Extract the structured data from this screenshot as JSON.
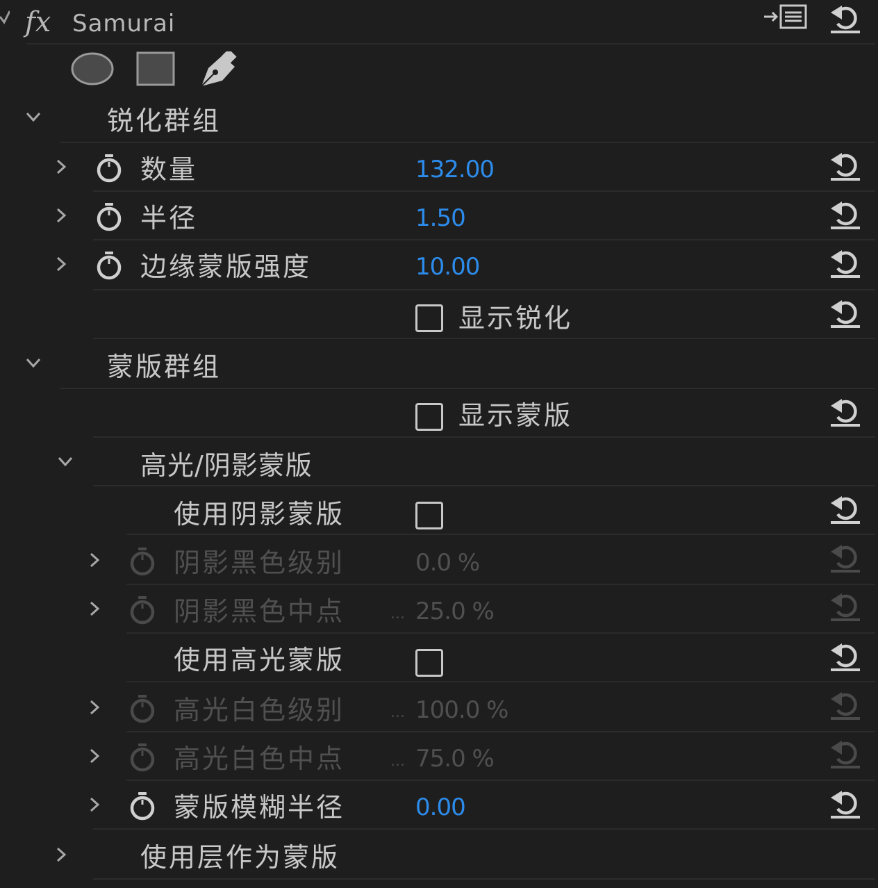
{
  "effect": {
    "name": "Samurai",
    "fx_label": "fx"
  },
  "header_icons": [
    "export-list-icon",
    "reset-icon"
  ],
  "mask_tools": [
    "ellipse-mask-icon",
    "rectangle-mask-icon",
    "pen-mask-icon"
  ],
  "groups": {
    "sharpen": {
      "label": "锐化群组"
    },
    "mask": {
      "label": "蒙版群组"
    },
    "highlight_shadow": {
      "label": "高光/阴影蒙版"
    },
    "use_layer": {
      "label": "使用层作为蒙版"
    }
  },
  "params": {
    "amount": {
      "label": "数量",
      "value": "132.00"
    },
    "radius": {
      "label": "半径",
      "value": "1.50"
    },
    "edge_mask": {
      "label": "边缘蒙版强度",
      "value": "10.00"
    },
    "show_sharpen": {
      "label": "显示锐化",
      "checked": false
    },
    "show_mask": {
      "label": "显示蒙版",
      "checked": false
    },
    "use_shadow_mask": {
      "label": "使用阴影蒙版",
      "checked": false
    },
    "shadow_black_level": {
      "label": "阴影黑色级别",
      "value": "0.0 %"
    },
    "shadow_black_mid": {
      "label": "阴影黑色中点",
      "value": "25.0 %",
      "ellipsis": "..."
    },
    "use_highlight_mask": {
      "label": "使用高光蒙版",
      "checked": false
    },
    "highlight_white_level": {
      "label": "高光白色级别",
      "value": "100.0 %",
      "ellipsis": "..."
    },
    "highlight_white_mid": {
      "label": "高光白色中点",
      "value": "75.0 %",
      "ellipsis": "..."
    },
    "mask_blur_radius": {
      "label": "蒙版模糊半径",
      "value": "0.00"
    }
  },
  "colors": {
    "bg": "#1e1e1e",
    "value_blue": "#2d8ceb",
    "text": "#c8c8c8",
    "disabled": "#505050",
    "separator": "#2b2b2b"
  }
}
